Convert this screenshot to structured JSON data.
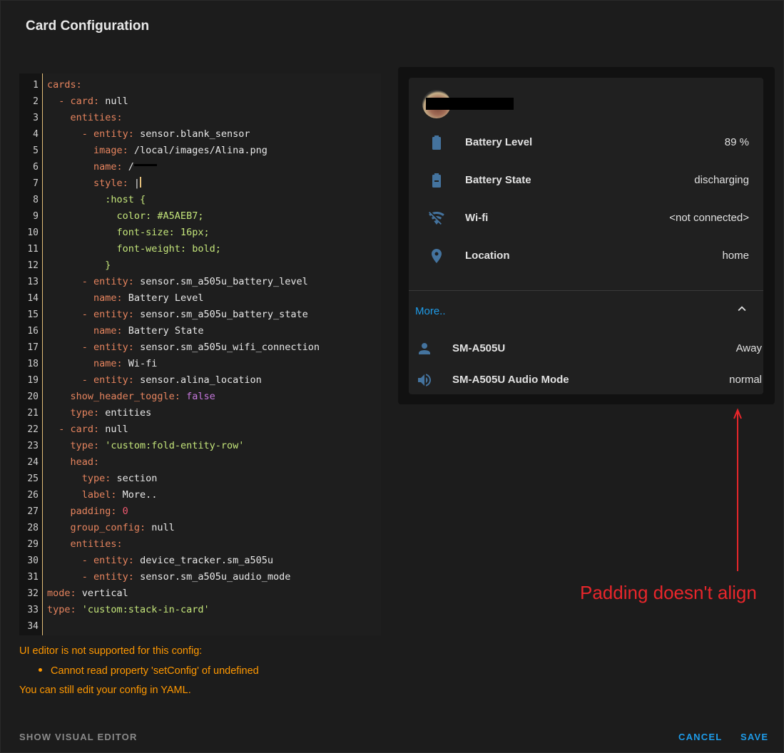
{
  "dialog": {
    "title": "Card Configuration"
  },
  "editor": {
    "lines": [
      [
        [
          "cards:",
          "k"
        ]
      ],
      [
        [
          "  - ",
          "k"
        ],
        [
          "card:",
          "k"
        ],
        [
          " null",
          "p"
        ]
      ],
      [
        [
          "    entities:",
          "k"
        ]
      ],
      [
        [
          "      - ",
          "k"
        ],
        [
          "entity:",
          "k"
        ],
        [
          " sensor.blank_sensor",
          "p"
        ]
      ],
      [
        [
          "        image:",
          "k"
        ],
        [
          " /local/images/Alina.png",
          "p"
        ]
      ],
      [
        [
          "        name:",
          "k"
        ],
        [
          " /",
          "p"
        ],
        [
          "__REDACT__",
          ""
        ]
      ],
      [
        [
          "        style:",
          "k"
        ],
        [
          " |",
          "p"
        ],
        [
          "__CURSOR__",
          ""
        ]
      ],
      [
        [
          "          :host {",
          "s"
        ]
      ],
      [
        [
          "            color: #A5AEB7;",
          "s"
        ]
      ],
      [
        [
          "            font-size: 16px;",
          "s"
        ]
      ],
      [
        [
          "            font-weight: bold;",
          "s"
        ]
      ],
      [
        [
          "          }",
          "s"
        ]
      ],
      [
        [
          "      - ",
          "k"
        ],
        [
          "entity:",
          "k"
        ],
        [
          " sensor.sm_a505u_battery_level",
          "p"
        ]
      ],
      [
        [
          "        name:",
          "k"
        ],
        [
          " Battery Level",
          "p"
        ]
      ],
      [
        [
          "      - ",
          "k"
        ],
        [
          "entity:",
          "k"
        ],
        [
          " sensor.sm_a505u_battery_state",
          "p"
        ]
      ],
      [
        [
          "        name:",
          "k"
        ],
        [
          " Battery State",
          "p"
        ]
      ],
      [
        [
          "      - ",
          "k"
        ],
        [
          "entity:",
          "k"
        ],
        [
          " sensor.sm_a505u_wifi_connection",
          "p"
        ]
      ],
      [
        [
          "        name:",
          "k"
        ],
        [
          " Wi-fi",
          "p"
        ]
      ],
      [
        [
          "      - ",
          "k"
        ],
        [
          "entity:",
          "k"
        ],
        [
          " sensor.alina_location",
          "p"
        ]
      ],
      [
        [
          "    show_header_toggle:",
          "k"
        ],
        [
          " false",
          "b"
        ]
      ],
      [
        [
          "    type:",
          "k"
        ],
        [
          " entities",
          "p"
        ]
      ],
      [
        [
          "  - ",
          "k"
        ],
        [
          "card:",
          "k"
        ],
        [
          " null",
          "p"
        ]
      ],
      [
        [
          "    type:",
          "k"
        ],
        [
          " 'custom:fold-entity-row'",
          "s"
        ]
      ],
      [
        [
          "    head:",
          "k"
        ]
      ],
      [
        [
          "      type:",
          "k"
        ],
        [
          " section",
          "p"
        ]
      ],
      [
        [
          "      label:",
          "k"
        ],
        [
          " More..",
          "p"
        ]
      ],
      [
        [
          "    padding:",
          "k"
        ],
        [
          " 0",
          "n"
        ]
      ],
      [
        [
          "    group_config:",
          "k"
        ],
        [
          " null",
          "p"
        ]
      ],
      [
        [
          "    entities:",
          "k"
        ]
      ],
      [
        [
          "      - ",
          "k"
        ],
        [
          "entity:",
          "k"
        ],
        [
          " device_tracker.sm_a505u",
          "p"
        ]
      ],
      [
        [
          "      - ",
          "k"
        ],
        [
          "entity:",
          "k"
        ],
        [
          " sensor.sm_a505u_audio_mode",
          "p"
        ]
      ],
      [
        [
          "mode:",
          "k"
        ],
        [
          " vertical",
          "p"
        ]
      ],
      [
        [
          "type:",
          "k"
        ],
        [
          " 'custom:stack-in-card'",
          "s"
        ]
      ],
      [
        [
          "",
          "p"
        ]
      ]
    ]
  },
  "warning": {
    "heading": "UI editor is not supported for this config:",
    "bullet": "Cannot read property 'setConfig' of undefined",
    "footer": "You can still edit your config in YAML."
  },
  "buttons": {
    "show_visual": "SHOW VISUAL EDITOR",
    "cancel": "CANCEL",
    "save": "SAVE"
  },
  "preview": {
    "rows": [
      {
        "icon": "battery-icon",
        "label": "Battery Level",
        "value": "89 %"
      },
      {
        "icon": "battery-minus-icon",
        "label": "Battery State",
        "value": "discharging"
      },
      {
        "icon": "wifi-off-icon",
        "label": "Wi-fi",
        "value": "<not connected>"
      },
      {
        "icon": "map-marker-icon",
        "label": "Location",
        "value": "home"
      }
    ],
    "more_label": "More..",
    "fold_rows": [
      {
        "icon": "account-icon",
        "label": "SM-A505U",
        "value": "Away"
      },
      {
        "icon": "speaker-icon",
        "label": "SM-A505U Audio Mode",
        "value": "normal"
      }
    ]
  },
  "annotation": {
    "text": "Padding doesn't align"
  },
  "colors": {
    "accent": "#1e9be8",
    "warning": "#ff9800",
    "icon": "#44739e",
    "annotation": "#e8262b"
  }
}
